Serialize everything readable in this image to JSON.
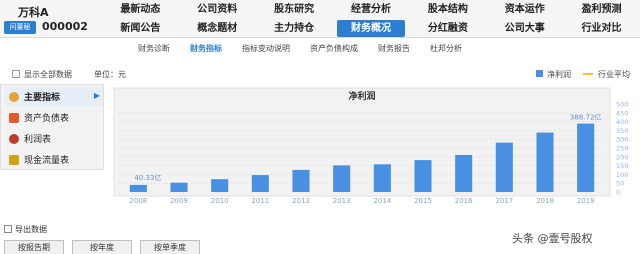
{
  "header": {
    "stock_name": "万科A",
    "stock_code": "000002",
    "dongmi_button": "问董秘",
    "nav": [
      {
        "label": "最新动态",
        "active": false
      },
      {
        "label": "公司资料",
        "active": false
      },
      {
        "label": "股东研究",
        "active": false
      },
      {
        "label": "经营分析",
        "active": false
      },
      {
        "label": "股本结构",
        "active": false
      },
      {
        "label": "资本运作",
        "active": false
      },
      {
        "label": "盈利预测",
        "active": false
      },
      {
        "label": "新闻公告",
        "active": false
      },
      {
        "label": "概念题材",
        "active": false
      },
      {
        "label": "主力持仓",
        "active": false
      },
      {
        "label": "财务概况",
        "active": true
      },
      {
        "label": "分红融资",
        "active": false
      },
      {
        "label": "公司大事",
        "active": false
      },
      {
        "label": "行业对比",
        "active": false
      }
    ]
  },
  "subtabs": [
    {
      "label": "财务诊断",
      "active": false
    },
    {
      "label": "财务指标",
      "active": true
    },
    {
      "label": "指标变动说明",
      "active": false
    },
    {
      "label": "资产负债构成",
      "active": false
    },
    {
      "label": "财务报告",
      "active": false
    },
    {
      "label": "杜邦分析",
      "active": false
    }
  ],
  "toolbar": {
    "show_all": "显示全部数据",
    "unit": "单位：元",
    "legend_net_profit": "净利润",
    "legend_industry_avg": "行业平均"
  },
  "sidebar": {
    "items": [
      {
        "label": "主要指标",
        "icon": "star-icon",
        "color": "#e8a23a"
      },
      {
        "label": "资产负债表",
        "icon": "balance-sheet-icon",
        "color": "#e05a2b"
      },
      {
        "label": "利润表",
        "icon": "profit-chart-icon",
        "color": "#c0392b"
      },
      {
        "label": "现金流量表",
        "icon": "cash-flow-icon",
        "color": "#d4a017"
      }
    ]
  },
  "colors": {
    "accent": "#2c7fd0",
    "bar": "#4a90e2",
    "industry_line": "#f0c24b",
    "plot_bg": "#f2f2f2"
  },
  "chart_data": {
    "type": "bar",
    "title": "净利润",
    "categories": [
      "2008",
      "2009",
      "2010",
      "2011",
      "2012",
      "2013",
      "2014",
      "2015",
      "2016",
      "2017",
      "2018",
      "2019"
    ],
    "series": [
      {
        "name": "净利润",
        "values": [
          40.33,
          53.0,
          72.8,
          96.2,
          125.5,
          151.2,
          157.5,
          181.2,
          210.2,
          280.5,
          337.7,
          388.72
        ]
      }
    ],
    "data_labels": {
      "first": "40.33亿",
      "last": "388.72亿"
    },
    "ylim": [
      0,
      500
    ],
    "yticks": [
      "0",
      "50",
      "100",
      "150",
      "200",
      "250",
      "300",
      "350",
      "400",
      "450",
      "500"
    ],
    "grid": true
  },
  "footer": {
    "export": "导出数据",
    "period_buttons": [
      "按报告期",
      "按年度",
      "按单季度"
    ],
    "watermark": "头条 @壹号股权"
  }
}
